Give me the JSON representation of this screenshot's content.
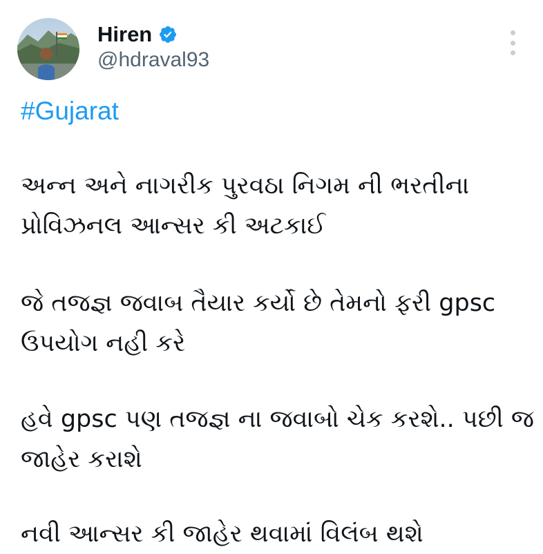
{
  "tweet": {
    "author": {
      "display_name": "Hiren",
      "handle": "@hdraval93",
      "verified_icon": "verified-badge-icon",
      "avatar_icon": "avatar-photo"
    },
    "more_icon": "vertical-ellipsis-icon",
    "hashtag": "#Gujarat",
    "paragraphs": [
      {
        "lines": [
          "અન્ન અને નાગરીક પુરવઠા નિગમ ની ભરતીના",
          "પ્રોવિઝનલ આન્સર કી અટકાઈ"
        ]
      },
      {
        "lines": [
          "જે તજજ્ઞ જવાબ તૈયાર કર્યો છે તેમનો ફરી gpsc",
          "ઉપયોગ નહી કરે"
        ]
      },
      {
        "lines": [
          "હવે gpsc પણ તજજ્ઞ ના જવાબો ચેક કરશે.. પછી જ",
          "જાહેર કરાશે"
        ]
      },
      {
        "lines": [
          "નવી આન્સર કી જાહેર થવામાં વિલંબ થશે"
        ]
      }
    ]
  },
  "colors": {
    "accent": "#1d9bf0",
    "text": "#0f1419",
    "secondary_text": "#536471"
  }
}
